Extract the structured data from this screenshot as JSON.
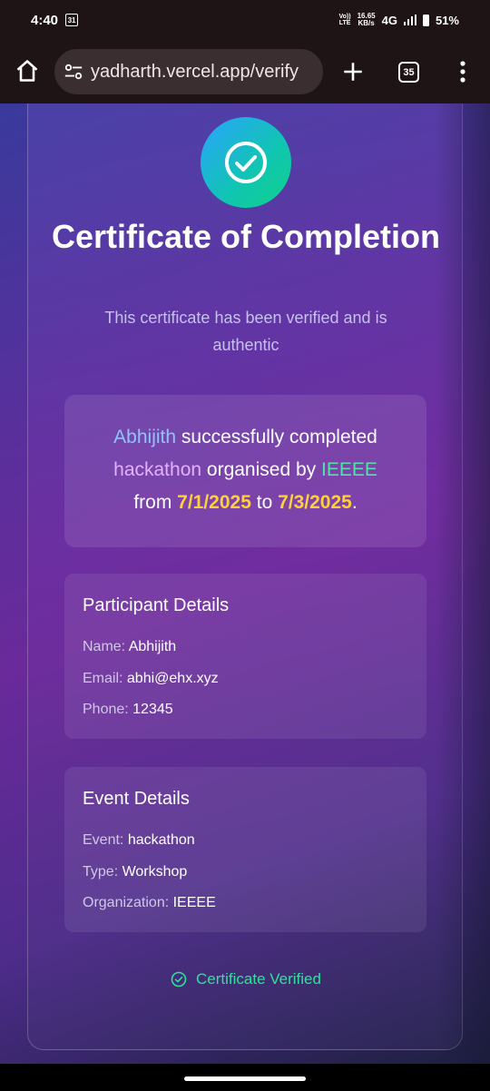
{
  "status": {
    "time": "4:40",
    "calendar_day": "31",
    "volte_line1": "Vo))",
    "volte_line2": "LTE",
    "speed_value": "16.65",
    "speed_unit": "KB/s",
    "network": "4G",
    "battery": "51%"
  },
  "browser": {
    "url": "yadharth.vercel.app/verify",
    "tab_count": "35"
  },
  "certificate": {
    "title": "Certificate of Completion",
    "subtitle": "This certificate has been verified and is authentic",
    "statement": {
      "name": "Abhijith",
      "text1": " successfully completed ",
      "event": "hackathon",
      "text2": " organised by ",
      "org": "IEEEE",
      "text3": "from ",
      "start_date": "7/1/2025",
      "text4": " to ",
      "end_date": "7/3/2025",
      "text5": "."
    },
    "participant": {
      "heading": "Participant Details",
      "name_label": "Name: ",
      "name_value": "Abhijith",
      "email_label": "Email: ",
      "email_value": "abhi@ehx.xyz",
      "phone_label": "Phone: ",
      "phone_value": "12345"
    },
    "event": {
      "heading": "Event Details",
      "event_label": "Event: ",
      "event_value": "hackathon",
      "type_label": "Type: ",
      "type_value": "Workshop",
      "org_label": "Organization: ",
      "org_value": "IEEEE"
    },
    "verified_label": "Certificate Verified"
  },
  "colors": {
    "accent_green": "#2ee29a",
    "name_blue": "#8fc3ff",
    "event_purple": "#e2b2ff",
    "org_green": "#56e1a8",
    "date_yellow": "#ffd03a"
  }
}
